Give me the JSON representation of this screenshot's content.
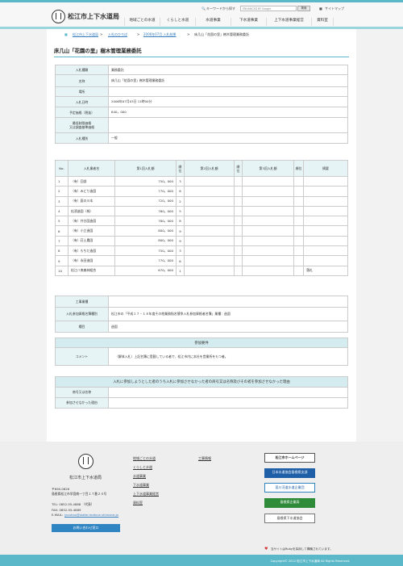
{
  "header": {
    "site_name": "松江市上下水道局",
    "keyword_label": "キーワードから探す",
    "search_placeholder": "ENHANCED BY Google",
    "search_button": "検索",
    "sitemap": "サイトマップ",
    "nav": [
      "地域ごとの水道",
      "くらしと水道",
      "水道事業",
      "下水道事業",
      "上下水道事業経営",
      "資料室"
    ]
  },
  "breadcrumb": [
    "松江市上下水道局",
    "入札のひろば",
    "2006年07月 入札結果",
    "床几山「花園の里」樹木管理業務委託"
  ],
  "page_title": "床几山「花園の里」樹木管理業務委託",
  "info_rows": [
    {
      "label": "入札種類",
      "value": "業務委託"
    },
    {
      "label": "名称",
      "value": "床几山「花園の里」樹木管理業務委託"
    },
    {
      "label": "場所",
      "value": ""
    },
    {
      "label": "入札日時",
      "value": "2006年07月03日 11時00分"
    },
    {
      "label": "予定価格（税抜）",
      "value": "640，000"
    },
    {
      "label": "最低制限価格\n又は調査基準価格",
      "value": ""
    },
    {
      "label": "入札種別",
      "value": "一般"
    }
  ],
  "bid_table": {
    "headers": [
      "No.",
      "入札業者名",
      "第1回入札額",
      "順位",
      "第2回入札額",
      "順位",
      "第3回入札額",
      "順位",
      "摘要"
    ],
    "rows": [
      [
        "1",
        "（有）回部",
        "750，000",
        "3",
        "",
        "",
        "",
        "",
        ""
      ],
      [
        "2",
        "（有）みどり造園",
        "770，000",
        "6",
        "",
        "",
        "",
        "",
        ""
      ],
      [
        "3",
        "（有）庭の川本",
        "720，000",
        "2",
        "",
        "",
        "",
        "",
        ""
      ],
      [
        "4",
        "松濱造園（株）",
        "760，000",
        "5",
        "",
        "",
        "",
        "",
        ""
      ],
      [
        "5",
        "（有）井谷園造園",
        "780，000",
        "8",
        "",
        "",
        "",
        "",
        ""
      ],
      [
        "6",
        "（有）小立造園",
        "800，000",
        "9",
        "",
        "",
        "",
        "",
        ""
      ],
      [
        "7",
        "（有）荘土農園",
        "800，000",
        "9",
        "",
        "",
        "",
        "",
        ""
      ],
      [
        "8",
        "（有）もちだ造園",
        "750，000",
        "3",
        "",
        "",
        "",
        "",
        ""
      ],
      [
        "9",
        "（有）永田造園",
        "770，000",
        "6",
        "",
        "",
        "",
        "",
        ""
      ],
      [
        "10",
        "松江八束森林組合",
        "670，000",
        "1",
        "",
        "",
        "",
        "",
        "落札"
      ]
    ]
  },
  "work_rows": [
    {
      "label": "工事業種",
      "value": ""
    },
    {
      "label": "入札参加資格名簿種別",
      "value": "松江市の「平成１７・１８年度その他業務指名競争入札参加資格者名簿」業種：造園"
    },
    {
      "label": "種目",
      "value": "造園"
    }
  ],
  "conditions": {
    "title": "参加要件",
    "comment_label": "コメント",
    "comment": "（解体入札）上記名簿に登載している者で、松江市内に本社を営業所をもつ者。"
  },
  "excluded": {
    "title": "入札に参加しようとした者のうち入札に参加させなかった者の商号又は名称及びその者を参加させなかった理由",
    "rows": [
      {
        "label": "商号又は名称",
        "value": ""
      },
      {
        "label": "参加させなかった理由",
        "value": ""
      }
    ]
  },
  "footer": {
    "name": "松江市上下水道局",
    "address": [
      "〒690-0826",
      "島根県松江市学園南一丁目１７番２４号"
    ],
    "tel": "TEL: 0852-55-4888 （代表）",
    "fax": "FAX: 0852-55-4889",
    "email_label": "E-MAIL:",
    "email": "jyouhou@water.matsue.shimane.jp",
    "contact_button": "お問い合わせ窓口",
    "links_col1": [
      "地域ごとの水道",
      "くらしと水道",
      "水道事業",
      "下水道事業",
      "上下水道事業経営",
      "資料室"
    ],
    "links_col2": [
      "工事情報"
    ],
    "banners": [
      "松江市ホームページ",
      "日本水道協会島根県支部",
      "斐川河道水道企業団",
      "島根県企業局",
      "島根県下水道協会"
    ],
    "ruby_note": "当サイトはRubyを採用して構築されています。",
    "copyright": "Copyright© 2012 松江市上下水道局 All Rights Reserved."
  }
}
